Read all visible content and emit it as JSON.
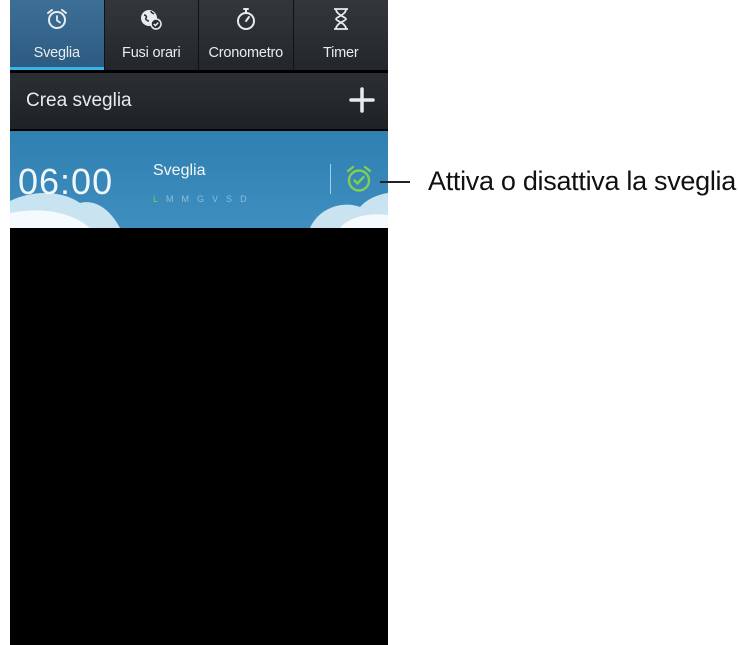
{
  "tabs": [
    {
      "label": "Sveglia",
      "icon": "alarm-clock-icon",
      "active": true
    },
    {
      "label": "Fusi orari",
      "icon": "world-clock-icon",
      "active": false
    },
    {
      "label": "Cronometro",
      "icon": "stopwatch-icon",
      "active": false
    },
    {
      "label": "Timer",
      "icon": "hourglass-icon",
      "active": false
    }
  ],
  "create_alarm": {
    "label": "Crea sveglia",
    "icon": "plus-icon"
  },
  "alarm": {
    "time": "06:00",
    "name": "Sveglia",
    "days": [
      "L",
      "M",
      "M",
      "G",
      "V",
      "S",
      "D"
    ],
    "active_days": [
      0
    ],
    "toggle_icon": "alarm-toggle-icon",
    "enabled": true
  },
  "annotation": {
    "text": "Attiva o disattiva la sveglia."
  },
  "colors": {
    "accent": "#38b5e6",
    "active_tab": "#2c5a80",
    "alarm_on": "#7fcf54"
  }
}
